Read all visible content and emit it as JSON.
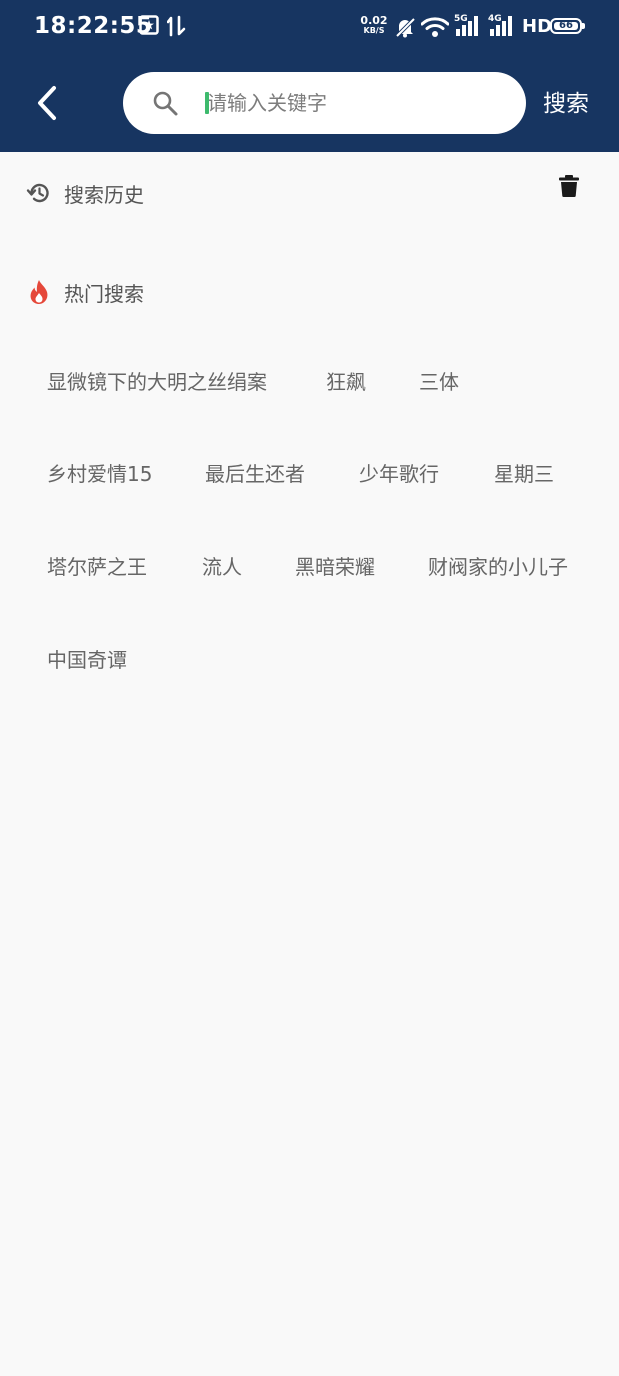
{
  "status_bar": {
    "time": "18:22:55",
    "net_speed_value": "0.02",
    "net_speed_unit": "KB/S",
    "net_5g_label": "5G",
    "net_4g_label": "4G",
    "hd_label": "HD",
    "battery_level": "66"
  },
  "search": {
    "placeholder": "请输入关键字",
    "value": "",
    "button_label": "搜索"
  },
  "history": {
    "title": "搜索历史"
  },
  "hot": {
    "title": "热门搜索",
    "tags": [
      "显微镜下的大明之丝绢案",
      "狂飙",
      "三体",
      "乡村爱情15",
      "最后生还者",
      "少年歌行",
      "星期三",
      "塔尔萨之王",
      "流人",
      "黑暗荣耀",
      "财阀家的小儿子",
      "中国奇谭"
    ]
  },
  "colors": {
    "header_bg": "#173561",
    "page_bg": "#f9f9f9",
    "hot_icon": "#e5483a",
    "caret": "#3dba6d"
  }
}
